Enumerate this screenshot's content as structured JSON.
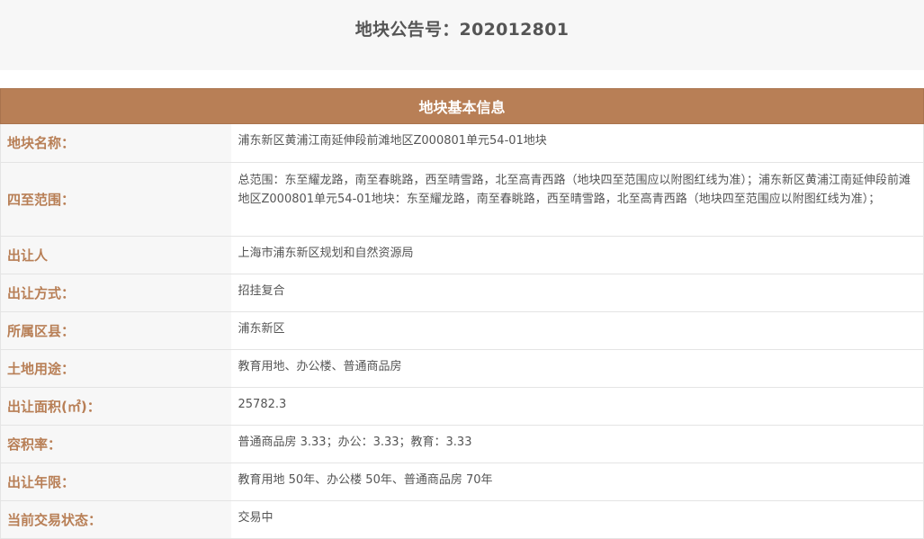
{
  "header": {
    "title": "地块公告号：202012801"
  },
  "panel": {
    "title": "地块基本信息"
  },
  "rows": [
    {
      "label": "地块名称：",
      "value": "浦东新区黄浦江南延伸段前滩地区Z000801单元54-01地块"
    },
    {
      "label": "四至范围：",
      "value": "总范围：东至耀龙路，南至春眺路，西至晴雪路，北至高青西路（地块四至范围应以附图红线为准）；浦东新区黄浦江南延伸段前滩地区Z000801单元54-01地块：东至耀龙路，南至春眺路，西至晴雪路，北至高青西路（地块四至范围应以附图红线为准）；"
    },
    {
      "label": "出让人",
      "value": "上海市浦东新区规划和自然资源局"
    },
    {
      "label": "出让方式：",
      "value": "招挂复合"
    },
    {
      "label": "所属区县：",
      "value": "浦东新区"
    },
    {
      "label": "土地用途：",
      "value": "教育用地、办公楼、普通商品房"
    },
    {
      "label": "出让面积(㎡)：",
      "value": "25782.3"
    },
    {
      "label": "容积率：",
      "value": "普通商品房 3.33；办公：3.33；教育：3.33"
    },
    {
      "label": "出让年限：",
      "value": "教育用地 50年、办公楼 50年、普通商品房 70年"
    },
    {
      "label": "当前交易状态：",
      "value": "交易中"
    }
  ],
  "colors": {
    "accent": "#b87f56",
    "label_bg": "#f7f7f7",
    "text": "#555555"
  }
}
